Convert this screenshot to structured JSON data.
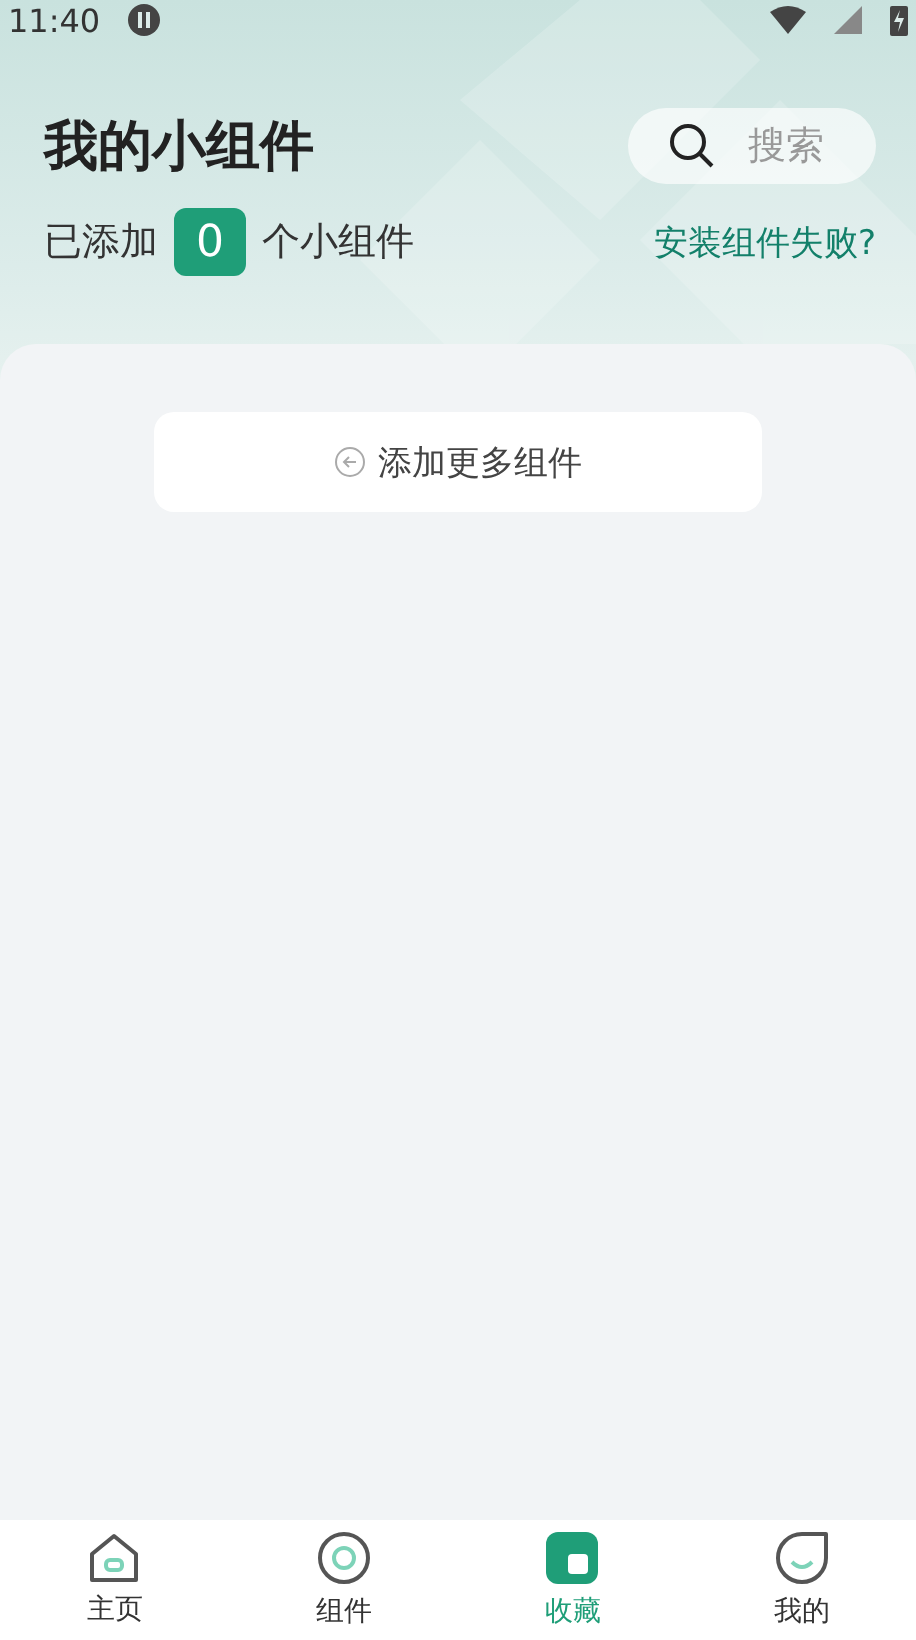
{
  "status_bar": {
    "time": "11:40"
  },
  "header": {
    "title": "我的小组件",
    "search": {
      "placeholder": "搜索"
    },
    "added_prefix": "已添加",
    "added_count": "0",
    "added_suffix": "个小组件",
    "help_link": "安装组件失败?"
  },
  "add_button": {
    "label": "添加更多组件"
  },
  "nav": [
    {
      "kind": "home",
      "label": "主页",
      "selected": false
    },
    {
      "kind": "widgets",
      "label": "组件",
      "selected": false
    },
    {
      "kind": "favorites",
      "label": "收藏",
      "selected": true
    },
    {
      "kind": "profile",
      "label": "我的",
      "selected": false
    }
  ]
}
